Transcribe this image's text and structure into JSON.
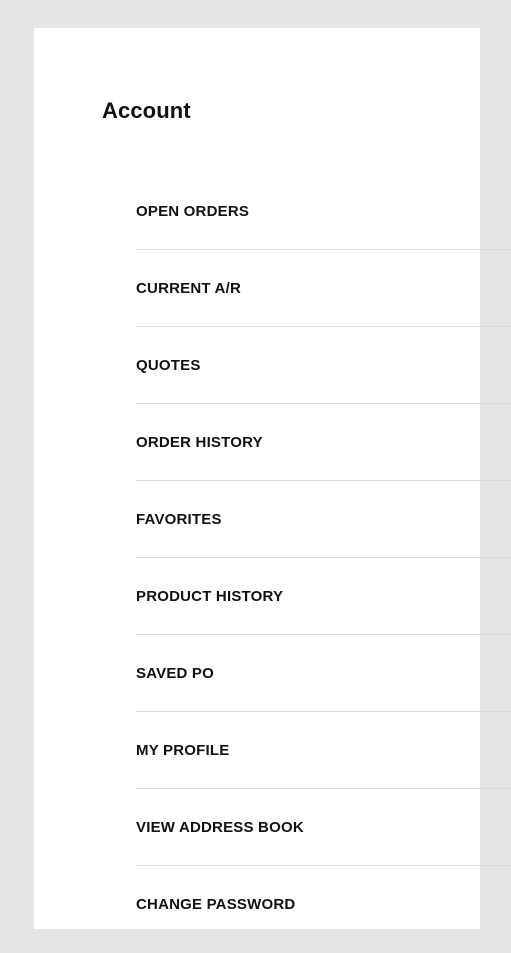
{
  "account_panel": {
    "title": "Account",
    "items": [
      {
        "label": "OPEN ORDERS"
      },
      {
        "label": "CURRENT A/R"
      },
      {
        "label": "QUOTES"
      },
      {
        "label": "ORDER HISTORY"
      },
      {
        "label": "FAVORITES"
      },
      {
        "label": "PRODUCT HISTORY"
      },
      {
        "label": "SAVED PO"
      },
      {
        "label": "MY PROFILE"
      },
      {
        "label": "VIEW ADDRESS BOOK"
      },
      {
        "label": "CHANGE PASSWORD"
      }
    ]
  }
}
